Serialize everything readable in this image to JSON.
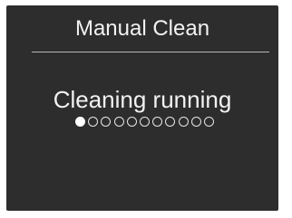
{
  "screen": {
    "title": "Manual Clean",
    "status": "Cleaning running",
    "progress": {
      "total_steps": 11,
      "current_step": 1
    }
  }
}
